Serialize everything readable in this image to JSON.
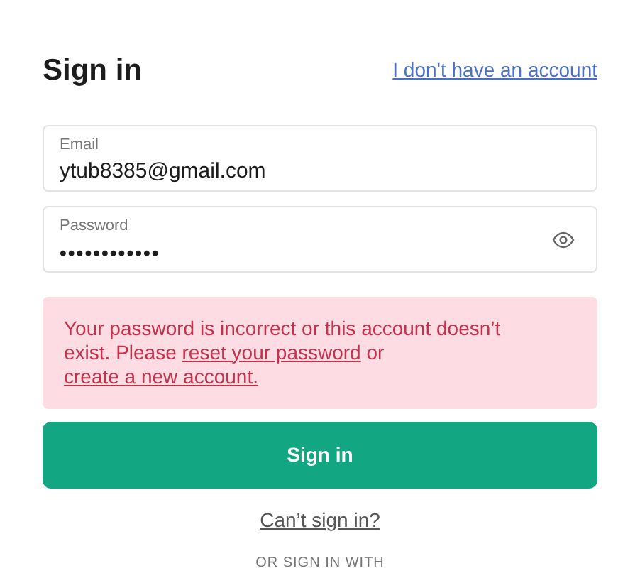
{
  "title": "Sign in",
  "switch_link": "I don't have an account",
  "fields": [
    {
      "label": "Email",
      "value": "ytub8385@gmail.com",
      "kind": "text"
    },
    {
      "label": "Password",
      "value": "••••••••••••",
      "kind": "password"
    }
  ],
  "error": [
    {
      "kind": "text",
      "text": "Your password is incorrect or this account doesn’t exist. Please "
    },
    {
      "kind": "link",
      "text": "reset your password"
    },
    {
      "kind": "text",
      "text": " or "
    },
    {
      "kind": "link",
      "text": "create a new account."
    }
  ],
  "submit": "Sign in",
  "help_link": "Can’t sign in?",
  "divider_text": "OR SIGN IN WITH"
}
